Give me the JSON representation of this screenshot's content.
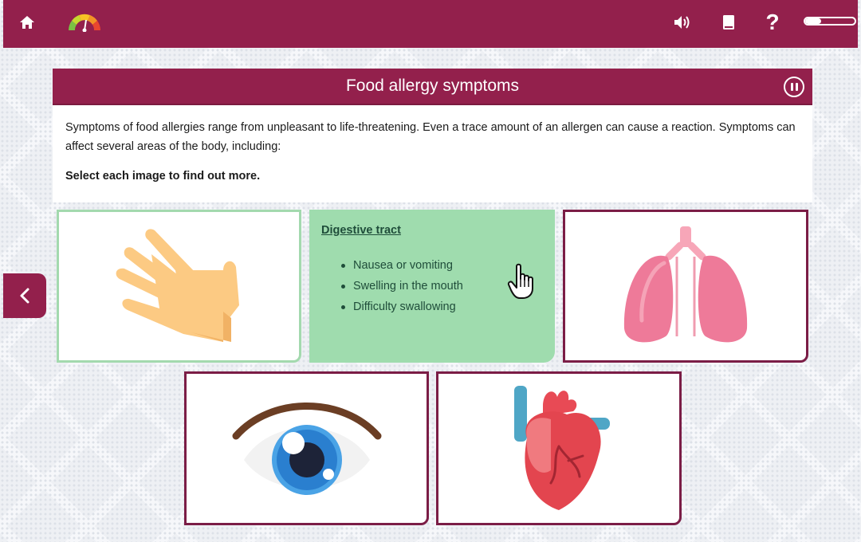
{
  "header": {
    "home_icon": "home-icon",
    "gauge_icon": "rating-gauge-icon",
    "sound_icon": "speaker-icon",
    "book_icon": "book-icon",
    "help_label": "?",
    "progress_fraction": 0.32,
    "colors": {
      "brand": "#93204c",
      "visited": "#a3d9ae",
      "revealed": "#9fdcae"
    }
  },
  "panel": {
    "title": "Food allergy symptoms",
    "pause_icon": "pause-icon",
    "intro": "Symptoms of food allergies range from unpleasant to life-threatening. Even a trace amount of an allergen can cause a reaction. Symptoms can affect several areas of the body, including:",
    "instruction": "Select each image to find out more."
  },
  "cards": {
    "skin": {
      "icon": "hand-icon"
    },
    "digestive": {
      "title": "Digestive tract",
      "items": [
        "Nausea or vomiting",
        "Swelling in the mouth",
        "Difficulty swallowing"
      ]
    },
    "lungs": {
      "icon": "lungs-icon"
    },
    "eyes": {
      "icon": "eye-icon"
    },
    "heart": {
      "icon": "heart-icon"
    }
  },
  "nav": {
    "back_icon": "chevron-left-icon"
  }
}
